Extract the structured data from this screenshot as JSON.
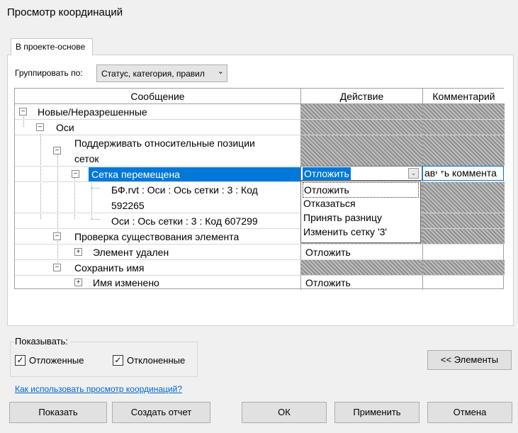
{
  "window": {
    "title": "Просмотр координаций"
  },
  "tabs": [
    {
      "label": "В проекте-основе"
    }
  ],
  "group": {
    "label": "Группировать по:",
    "value": "Статус, категория, правил"
  },
  "grid": {
    "columns": [
      "Сообщение",
      "Действие",
      "Комментарий"
    ],
    "rows": [
      {
        "message": "Новые/Неразрешенные",
        "action": ""
      },
      {
        "message": "Оси",
        "action": ""
      },
      {
        "message_line1": "Поддерживать относительные позиции",
        "message_line2": "сеток",
        "action": ""
      },
      {
        "message": "Сетка перемещена",
        "action": "Отложить",
        "comment": "авьть коммента"
      },
      {
        "message_line1": "БФ.rvt : Оси : Ось сетки : 3 : Код",
        "message_line2": "592265"
      },
      {
        "message": "Оси : Ось сетки : 3 : Код 607299"
      },
      {
        "message": "Проверка существования элемента"
      },
      {
        "message": "Элемент удален",
        "action": "Отложить"
      },
      {
        "message": "Сохранить имя"
      },
      {
        "message": "Имя изменено",
        "action": "Отложить"
      }
    ]
  },
  "dropdown": {
    "options": [
      "Отложить",
      "Отказаться",
      "Принять разницу",
      "Изменить сетку '3'"
    ]
  },
  "show": {
    "label": "Показывать:",
    "options": [
      {
        "label": "Отложенные",
        "checked": true
      },
      {
        "label": "Отклоненные",
        "checked": true
      }
    ]
  },
  "elements_button": "<< Элементы",
  "help_link": "Как использовать просмотр координаций?",
  "buttons": {
    "show": "Показать",
    "report": "Создать отчет",
    "ok": "ОК",
    "apply": "Применить",
    "cancel": "Отмена"
  },
  "icons": {
    "expand": "plus-box-icon",
    "collapse": "minus-box-icon",
    "check": "check-icon",
    "chevron": "chevron-down-icon"
  }
}
